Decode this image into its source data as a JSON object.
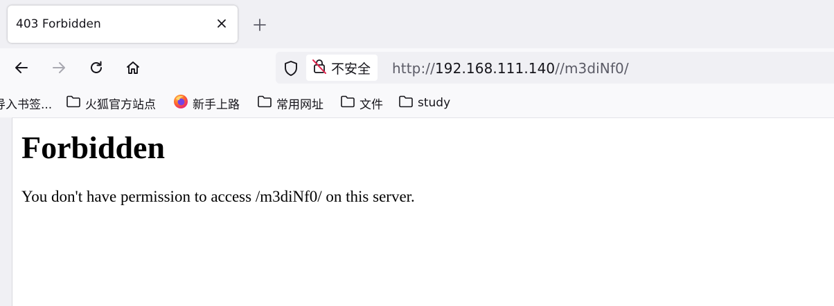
{
  "browser": {
    "tab": {
      "title": "403 Forbidden"
    },
    "address_bar": {
      "security_label": "不安全",
      "url_scheme": "http://",
      "url_host": "192.168.111.140",
      "url_path": "//m3diNf0/"
    },
    "bookmarks": [
      {
        "label": "导入书签...",
        "icon": "none"
      },
      {
        "label": "火狐官方站点",
        "icon": "folder-icon"
      },
      {
        "label": "新手上路",
        "icon": "firefox-icon"
      },
      {
        "label": "常用网址",
        "icon": "folder-icon"
      },
      {
        "label": "文件",
        "icon": "folder-icon"
      },
      {
        "label": "study",
        "icon": "folder-icon"
      }
    ]
  },
  "page": {
    "heading": "Forbidden",
    "message": "You don't have permission to access /m3diNf0/ on this server."
  }
}
